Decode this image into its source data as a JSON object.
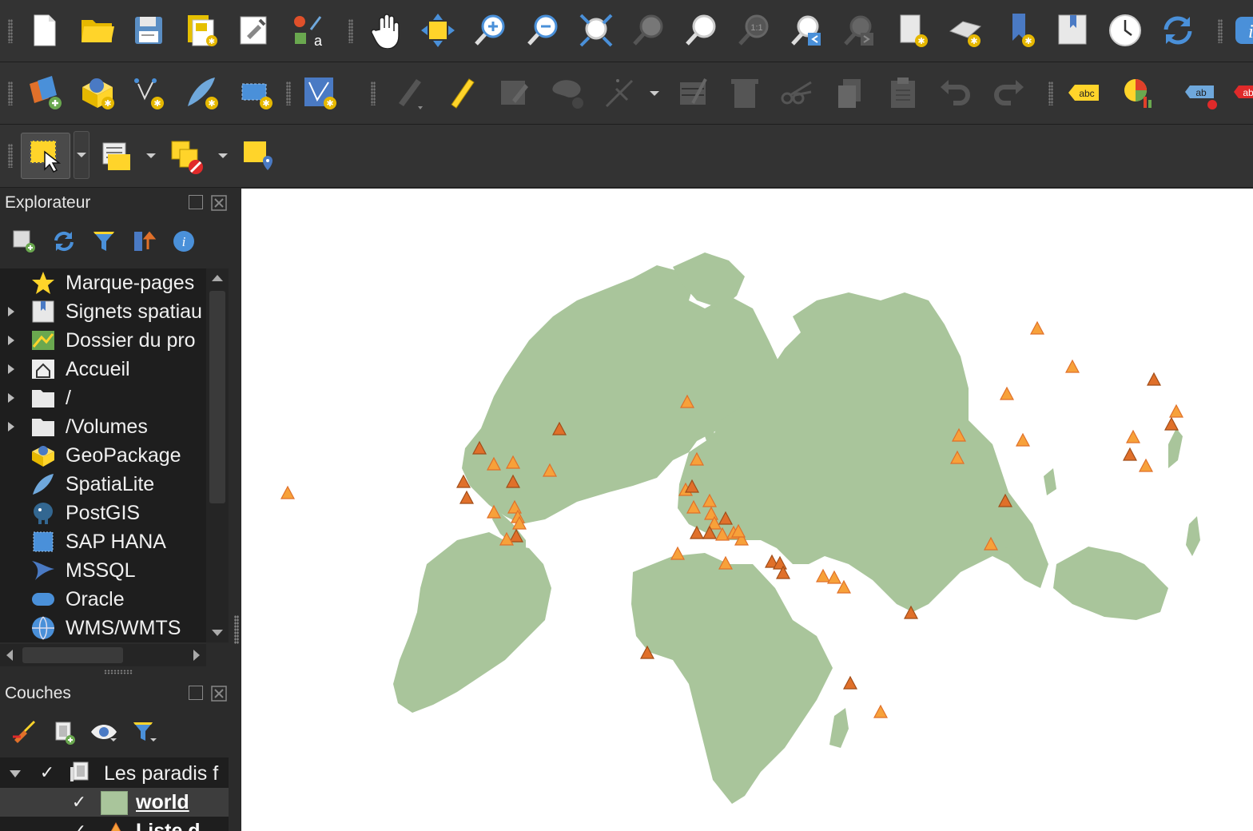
{
  "toolbars": {
    "file": [
      "new-project",
      "open-project",
      "save-project",
      "new-print-layout",
      "style-manager",
      "label-tool"
    ],
    "navigation": [
      "pan",
      "pan-to-selection",
      "zoom-in",
      "zoom-out",
      "zoom-full",
      "zoom-to-selection",
      "zoom-to-layer",
      "zoom-native",
      "zoom-last",
      "zoom-next",
      "new-map-view",
      "new-3d-view",
      "new-bookmark",
      "show-bookmarks",
      "temporal-controller",
      "refresh"
    ],
    "data_source": [
      "data-source-manager",
      "new-geopackage-layer",
      "new-shapefile-layer",
      "new-spatialite-layer",
      "new-virtual-layer",
      "new-temporary-layer"
    ],
    "digitizing": [
      "current-edits",
      "toggle-editing",
      "save-edits",
      "add-feature",
      "move-feature",
      "vertex-tool",
      "modify-attributes",
      "delete-selected",
      "cut-features",
      "copy-features",
      "paste-features",
      "undo",
      "redo"
    ],
    "labels": [
      "label-toolbar",
      "diagram",
      "pin-label"
    ],
    "selection": [
      "select-features",
      "select-by-value",
      "deselect",
      "select-by-location"
    ]
  },
  "browser": {
    "title": "Explorateur",
    "items": [
      {
        "label": "Marque-pages",
        "icon": "star-icon",
        "expandable": false
      },
      {
        "label": "Signets spatiau",
        "icon": "bookmark-icon",
        "expandable": true
      },
      {
        "label": "Dossier du pro",
        "icon": "project-folder-icon",
        "expandable": true
      },
      {
        "label": "Accueil",
        "icon": "home-icon",
        "expandable": true
      },
      {
        "label": "/",
        "icon": "folder-icon",
        "expandable": true
      },
      {
        "label": "/Volumes",
        "icon": "folder-icon",
        "expandable": true
      },
      {
        "label": "GeoPackage",
        "icon": "geopackage-icon",
        "expandable": false
      },
      {
        "label": "SpatiaLite",
        "icon": "feather-icon",
        "expandable": false
      },
      {
        "label": "PostGIS",
        "icon": "elephant-icon",
        "expandable": false
      },
      {
        "label": "SAP HANA",
        "icon": "hana-icon",
        "expandable": false
      },
      {
        "label": "MSSQL",
        "icon": "mssql-icon",
        "expandable": false
      },
      {
        "label": "Oracle",
        "icon": "oracle-icon",
        "expandable": false
      },
      {
        "label": "WMS/WMTS",
        "icon": "globe-icon",
        "expandable": false
      }
    ]
  },
  "layers": {
    "title": "Couches",
    "items": [
      {
        "label": "Les paradis f",
        "type": "group",
        "checked": true
      },
      {
        "label": "world",
        "type": "polygon",
        "checked": true,
        "color": "#a9c59b"
      },
      {
        "label": "Liste d",
        "type": "point",
        "checked": true
      }
    ]
  },
  "map": {
    "land_color": "#a9c59b",
    "marker_light": "#f7a13a",
    "marker_dark": "#e0702a"
  }
}
